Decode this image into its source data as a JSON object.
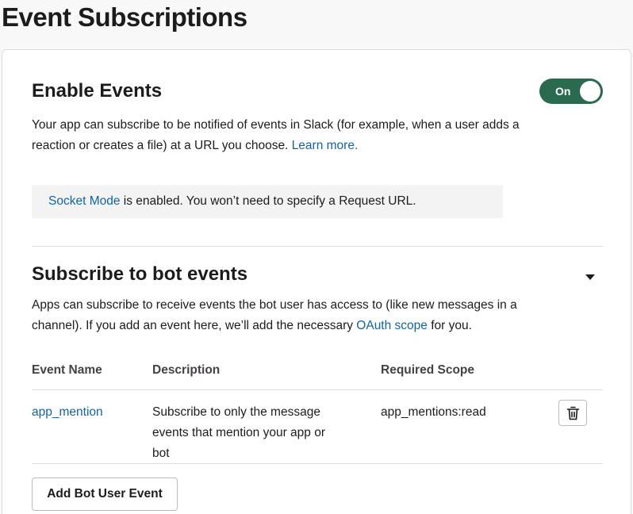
{
  "page": {
    "title": "Event Subscriptions"
  },
  "enable_events": {
    "title": "Enable Events",
    "toggle_label": "On",
    "description": "Your app can subscribe to be notified of events in Slack (for example, when a user adds a",
    "description_line2": "reaction or creates a file) at a URL you choose. ",
    "learn_more": "Learn more.",
    "notice_link": "Socket Mode",
    "notice_text": " is enabled. You won’t need to specify a Request URL."
  },
  "bot_events": {
    "title": "Subscribe to bot events",
    "description_line1": "Apps can subscribe to receive events the bot user has access to (like new messages in a",
    "description_line2": "channel). If you add an event here, we’ll add the necessary ",
    "oauth_link": "OAuth scope",
    "description_line2_end": " for you.",
    "columns": [
      "Event Name",
      "Description",
      "Required Scope"
    ],
    "rows": [
      {
        "event_name": "app_mention",
        "description": "Subscribe to only the message events that mention your app or bot",
        "description_lines": [
          "Subscribe to only the message",
          "events that mention your app or",
          "bot"
        ],
        "scope": "app_mentions:read"
      }
    ],
    "add_button": "Add Bot User Event"
  },
  "colors": {
    "link": "#1264a3",
    "toggle_on": "#2a6b50"
  }
}
